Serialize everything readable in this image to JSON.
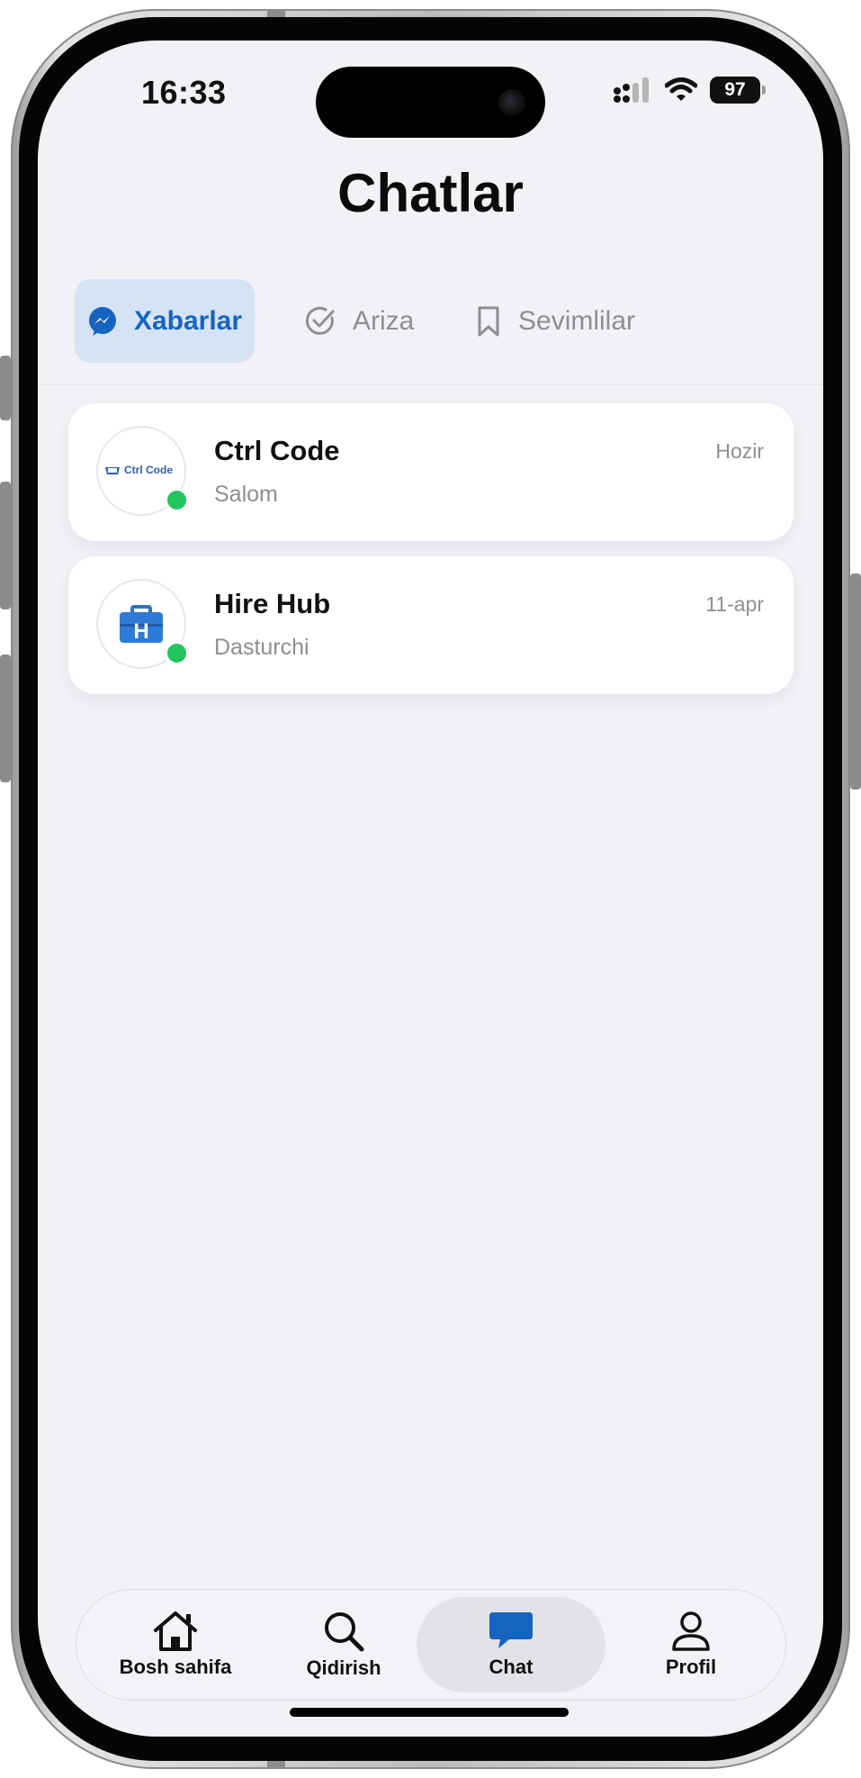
{
  "status_bar": {
    "time": "16:33",
    "battery": "97"
  },
  "page": {
    "title": "Chatlar"
  },
  "tabs": [
    {
      "label": "Xabarlar",
      "icon": "messenger-icon",
      "active": true
    },
    {
      "label": "Ariza",
      "icon": "check-circle-icon",
      "active": false
    },
    {
      "label": "Sevimlilar",
      "icon": "bookmark-icon",
      "active": false
    }
  ],
  "chats": [
    {
      "name": "Ctrl Code",
      "subtitle": "Salom",
      "time": "Hozir",
      "online": true,
      "avatar_text": "Ctrl Code"
    },
    {
      "name": "Hire Hub",
      "subtitle": "Dasturchi",
      "time": "11-apr",
      "online": true,
      "avatar_text": "H"
    }
  ],
  "bottom_nav": [
    {
      "label": "Bosh sahifa",
      "icon": "home-icon",
      "active": false
    },
    {
      "label": "Qidirish",
      "icon": "search-icon",
      "active": false
    },
    {
      "label": "Chat",
      "icon": "chat-bubble-icon",
      "active": true
    },
    {
      "label": "Profil",
      "icon": "person-icon",
      "active": false
    }
  ],
  "colors": {
    "accent": "#1565c0",
    "active_tab_bg": "#d6e3f5",
    "online": "#22c55e",
    "screen_bg": "#f1f1f6"
  }
}
